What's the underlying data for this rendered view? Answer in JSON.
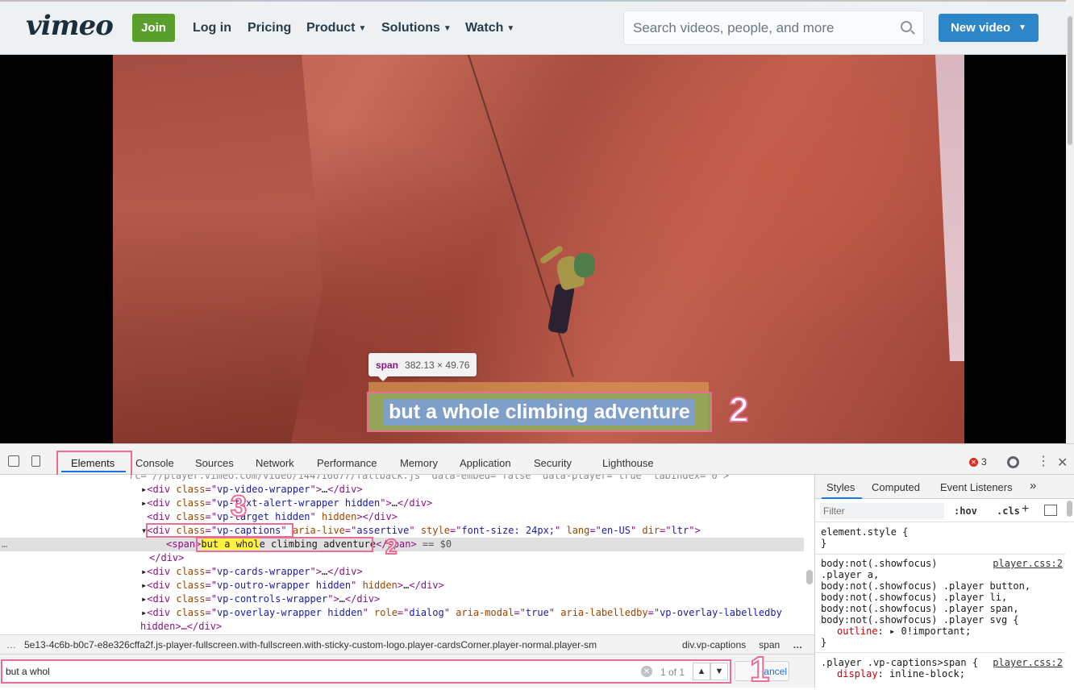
{
  "header": {
    "logo": "vimeo",
    "join_label": "Join",
    "nav": [
      {
        "label": "Log in",
        "chevron": false
      },
      {
        "label": "Pricing",
        "chevron": false
      },
      {
        "label": "Product",
        "chevron": true
      },
      {
        "label": "Solutions",
        "chevron": true
      },
      {
        "label": "Watch",
        "chevron": true
      }
    ],
    "search_placeholder": "Search videos, people, and more",
    "new_video_label": "New video"
  },
  "video": {
    "caption_text": "but a whole climbing adventure",
    "tooltip_tag": "span",
    "tooltip_size": "382.13 × 49.76"
  },
  "annotations": {
    "a1": "1",
    "a2": "2",
    "a3": "3"
  },
  "devtools": {
    "tabs": [
      "Elements",
      "Console",
      "Sources",
      "Network",
      "Performance",
      "Memory",
      "Application",
      "Security",
      "Lighthouse"
    ],
    "active_tab": "Elements",
    "error_count": "3",
    "dom": {
      "line0": "rc=\"//player.vimeo.com/video/144716677/fallback.js\" data-embed=\"false\" data-player=\"true\" tabindex=\"0\">",
      "video_wrapper": "vp-video-wrapper",
      "alert_wrapper": "vp-text-alert-wrapper hidden",
      "target_hidden": "vp-target hidden",
      "captions_class": "vp-captions",
      "captions_attrs_aria": "assertive",
      "captions_attrs_style": "font-size: 24px;",
      "captions_attrs_lang": "en-US",
      "captions_attrs_dir": "ltr",
      "span_match": "but a whol",
      "span_rest": "e climbing adventure",
      "eq_sign": "== $0",
      "cards_wrapper": "vp-cards-wrapper",
      "outro_wrapper": "vp-outro-wrapper hidden",
      "controls_wrapper": "vp-controls-wrapper",
      "overlay_wrapper": "vp-overlay-wrapper hidden",
      "overlay_role": "dialog",
      "overlay_modal": "true",
      "overlay_labelledby": "vp-overlay-labelledby",
      "hidden_line": "hidden>…</div>"
    },
    "breadcrumb": {
      "item1": "5e13-4c6b-b0c7-e8e326cffa2f.js-player-fullscreen.with-fullscreen.with-sticky-custom-logo.player-cardsCorner.player-normal.player-sm",
      "item2": "div.vp-captions",
      "item3": "span",
      "more": "…",
      "ellipsis_left": "…"
    },
    "find": {
      "value": "but a whol",
      "match_count": "1 of 1",
      "cancel_label": "Cancel"
    },
    "styles": {
      "tabs": [
        "Styles",
        "Computed",
        "Event Listeners"
      ],
      "more_tabs": "»",
      "filter_placeholder": "Filter",
      "hov": ":hov",
      "cls": ".cls",
      "plus": "+",
      "rule1": "element.style {\n}",
      "rule2_selector": "body:not(.showfocus)\n.player a,\nbody:not(.showfocus) .player button,\nbody:not(.showfocus) .player li,\nbody:not(.showfocus) .player span,\nbody:not(.showfocus) .player svg {",
      "rule2_prop": "outline",
      "rule2_value": ": ▸ 0!important;",
      "rule2_close": "}",
      "rule2_source": "player.css:2",
      "rule3_selector": ".player .vp-captions>span {",
      "rule3_prop": "display",
      "rule3_value": ": inline-block;",
      "rule3_source": "player.css:2"
    }
  }
}
